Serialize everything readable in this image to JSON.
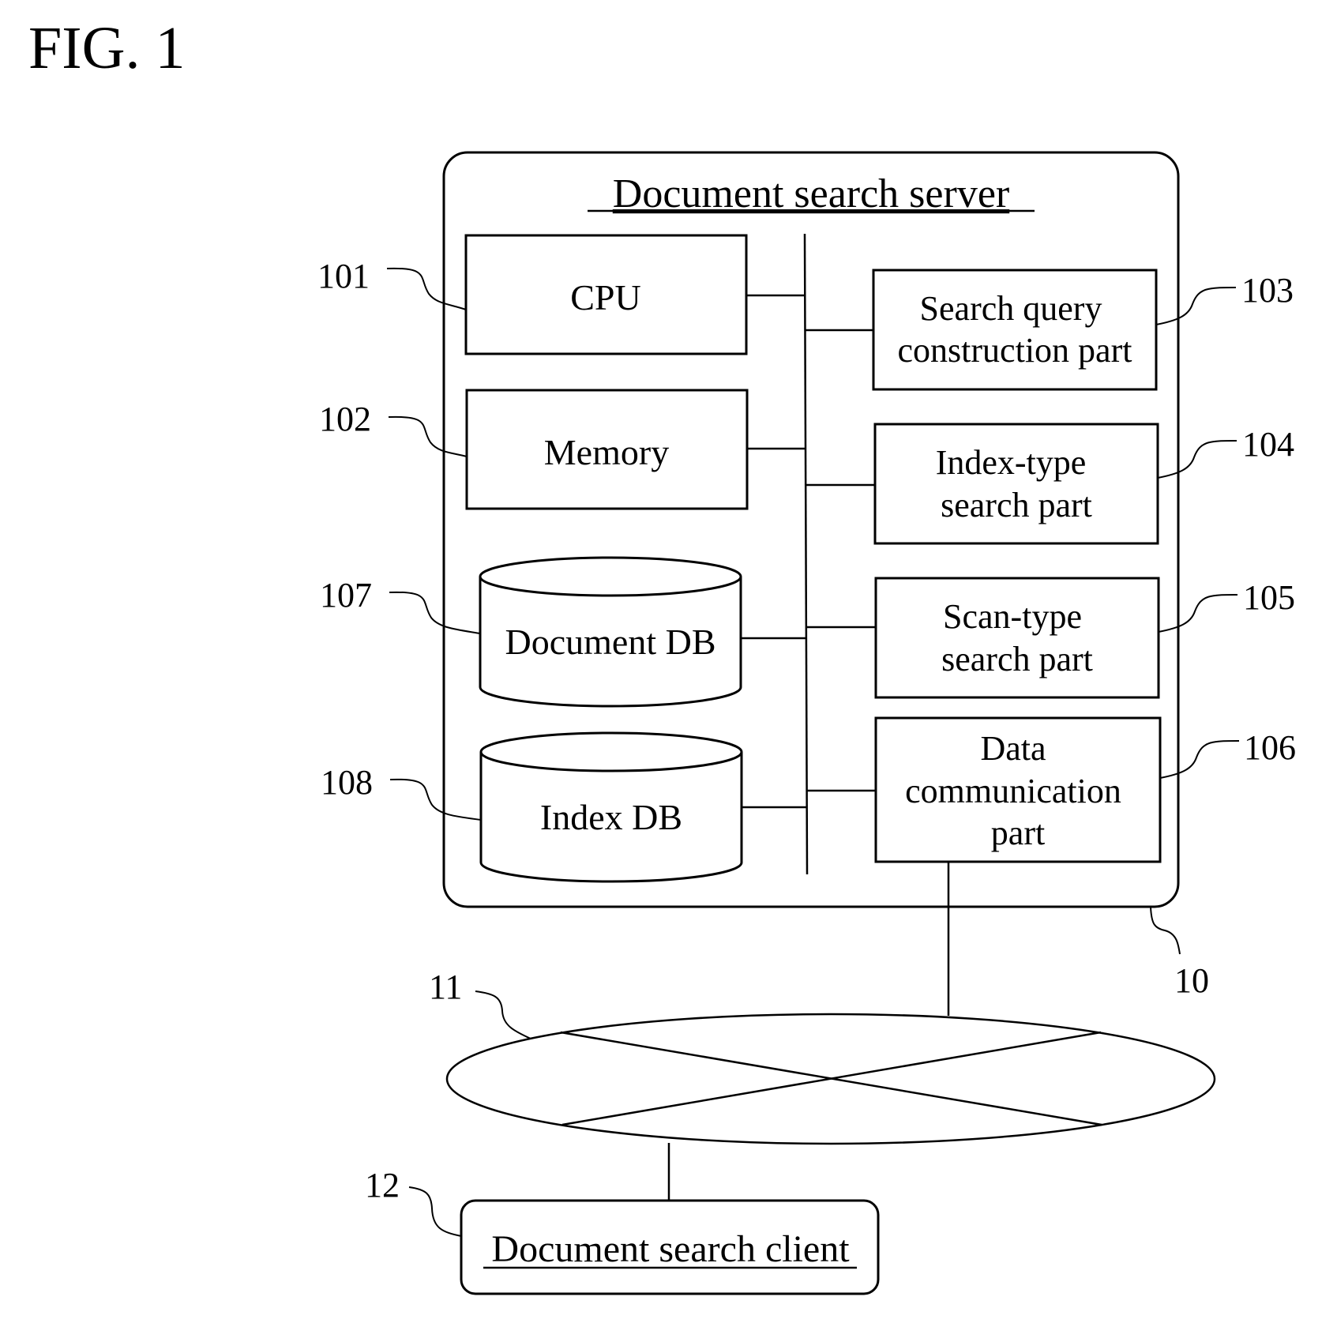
{
  "figure_title": "FIG. 1",
  "server": {
    "title": "Document search server",
    "ref": "10",
    "components": {
      "cpu": {
        "label": "CPU",
        "ref": "101"
      },
      "memory": {
        "label": "Memory",
        "ref": "102"
      },
      "query": {
        "line1": "Search query",
        "line2": "construction part",
        "ref": "103"
      },
      "index_search": {
        "line1": "Index-type",
        "line2": "search part",
        "ref": "104"
      },
      "scan_search": {
        "line1": "Scan-type",
        "line2": "search part",
        "ref": "105"
      },
      "datacomm": {
        "line1": "Data",
        "line2": "communication",
        "line3": "part",
        "ref": "106"
      },
      "document_db": {
        "label": "Document DB",
        "ref": "107"
      },
      "index_db": {
        "label": "Index DB",
        "ref": "108"
      }
    }
  },
  "network": {
    "ref": "11"
  },
  "client": {
    "label": "Document search client",
    "ref": "12"
  }
}
